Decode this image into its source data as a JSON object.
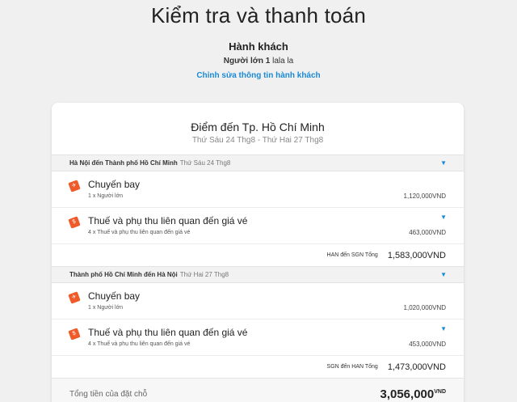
{
  "page": {
    "title": "Kiểm tra và thanh toán"
  },
  "passengers": {
    "heading": "Hành khách",
    "adult_label": "Người lớn 1",
    "adult_name": "lala la",
    "edit_link": "Chỉnh sửa thông tin hành khách"
  },
  "destination": {
    "title": "Điểm đến Tp. Hồ Chí Minh",
    "dates": "Thứ Sáu 24 Thg8 - Thứ Hai 27 Thg8"
  },
  "legs": [
    {
      "route": "Hà Nội đến Thành phố Hồ Chí Minh",
      "date": "Thứ Sáu 24 Thg8",
      "flight": {
        "title": "Chuyến bay",
        "sub": "1 x Người lớn",
        "price": "1,120,000VND"
      },
      "taxes": {
        "title": "Thuế và phụ thu liên quan đến giá vé",
        "sub": "4 x Thuế và phụ thu liên quan đến giá vé",
        "price": "463,000VND"
      },
      "total_label": "HAN đến SGN Tổng",
      "total_value": "1,583,000VND"
    },
    {
      "route": "Thành phố Hồ Chí Minh đến Hà Nội",
      "date": "Thứ Hai 27 Thg8",
      "flight": {
        "title": "Chuyến bay",
        "sub": "1 x Người lớn",
        "price": "1,020,000VND"
      },
      "taxes": {
        "title": "Thuế và phụ thu liên quan đến giá vé",
        "sub": "4 x Thuế và phụ thu liên quan đến giá vé",
        "price": "453,000VND"
      },
      "total_label": "SGN đến HAN Tổng",
      "total_value": "1,473,000VND"
    }
  ],
  "grand_total": {
    "label": "Tổng tiền của đặt chỗ",
    "value": "3,056,000",
    "currency": "VND"
  },
  "icons": {
    "ticket": "ticket-icon",
    "tag": "tag-icon",
    "chevron": "chevron-down-icon"
  },
  "colors": {
    "accent": "#1a8ad4",
    "icon": "#f05a28",
    "background": "#f0f0f0"
  }
}
